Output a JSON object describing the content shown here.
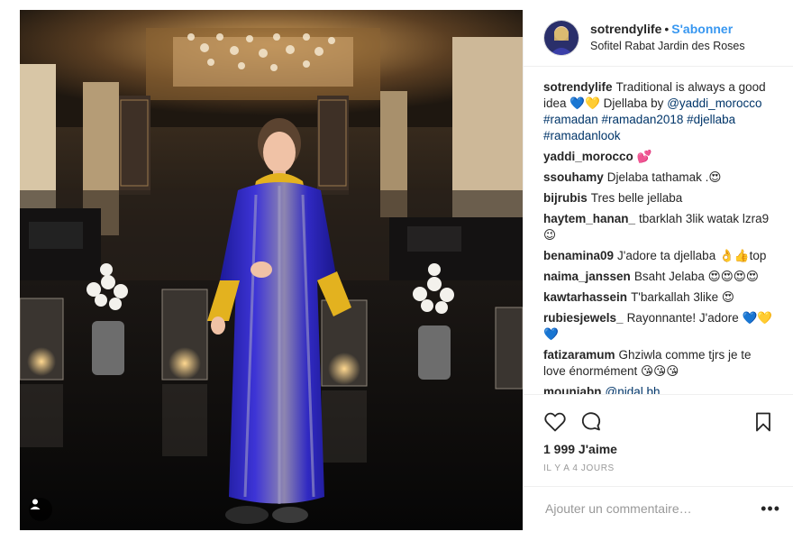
{
  "post": {
    "username": "sotrendylife",
    "dot": "•",
    "follow_label": "S'abonner",
    "location": "Sofitel Rabat Jardin des Roses",
    "caption": {
      "author": "sotrendylife",
      "text": "Traditional is always a good idea 💙💛 Djellaba by",
      "mention": "@yaddi_morocco",
      "hashtags": "#ramadan #ramadan2018 #djellaba #ramadanlook"
    },
    "comments": [
      {
        "author": "yaddi_morocco",
        "text": "💕"
      },
      {
        "author": "ssouhamy",
        "text": "Djelaba tathamak .😍"
      },
      {
        "author": "bijrubis",
        "text": "Tres belle jellaba"
      },
      {
        "author": "haytem_hanan_",
        "text": "tbarklah 3lik watak lzra9 😉"
      },
      {
        "author": "benamina09",
        "text": "J'adore ta djellaba 👌👍top"
      },
      {
        "author": "naima_janssen",
        "text": "Bsaht Jelaba 😍😍😍😍"
      },
      {
        "author": "kawtarhassein",
        "text": "T'barkallah 3like 😍"
      },
      {
        "author": "rubiesjewels_",
        "text": "Rayonnante! J'adore 💙💛💙"
      },
      {
        "author": "fatizaramum",
        "text": "Ghziwla comme tjrs je te love énormément 😘😘😘"
      }
    ],
    "last_comment": {
      "author": "mouniabn",
      "mention": "@nidal.bh"
    },
    "likes": "1 999 J'aime",
    "time": "IL Y A 4 JOURS",
    "comment_placeholder": "Ajouter un commentaire…",
    "more_label": "•••"
  },
  "icons": {
    "like": "heart-icon",
    "comment": "comment-bubble-icon",
    "save": "bookmark-icon",
    "user_tag": "user-tag-icon"
  },
  "colors": {
    "accent": "#3897f0",
    "link": "#003569",
    "text": "#262626",
    "muted": "#999999"
  }
}
